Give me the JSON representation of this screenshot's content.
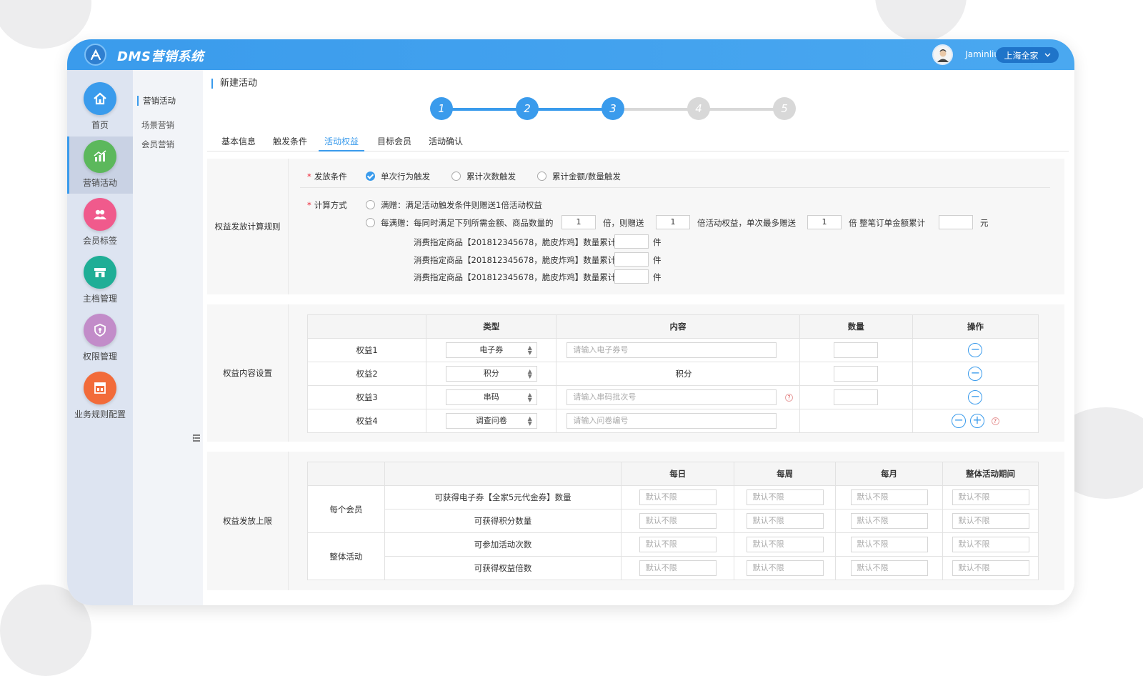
{
  "app": {
    "title": "DMS营销系统",
    "user": "Jaminliu",
    "store": "上海全家"
  },
  "sidebar": {
    "items": [
      {
        "label": "首页",
        "icon": "home-icon",
        "color": "#3a9bec"
      },
      {
        "label": "营销活动",
        "icon": "chart-icon",
        "color": "#5cb85c"
      },
      {
        "label": "会员标签",
        "icon": "members-icon",
        "color": "#f05a8c"
      },
      {
        "label": "主档管理",
        "icon": "store-icon",
        "color": "#1fae96"
      },
      {
        "label": "权限管理",
        "icon": "shield-icon",
        "color": "#c28cc9"
      },
      {
        "label": "业务规则配置",
        "icon": "rules-icon",
        "color": "#f26b3a"
      }
    ],
    "active_index": 1
  },
  "subnav": {
    "header": "营销活动",
    "items": [
      "场景营销",
      "会员营销"
    ]
  },
  "page": {
    "title": "新建活动",
    "steps": [
      "1",
      "2",
      "3",
      "4",
      "5"
    ],
    "current_step": 3,
    "tabs": [
      "基本信息",
      "触发条件",
      "活动权益",
      "目标会员",
      "活动确认"
    ],
    "active_tab": 2
  },
  "calc_rules": {
    "label": "权益发放计算规则",
    "trigger_label": "发放条件",
    "trigger_options": [
      "单次行为触发",
      "累计次数触发",
      "累计金额/数量触发"
    ],
    "trigger_selected": 0,
    "method_label": "计算方式",
    "method_option1": "满赠：满足活动触发条件则赠送1倍活动权益",
    "method_option2_prefix": "每满赠：每同时满足下列所需金额、商品数量的",
    "multiple_value": "1",
    "text_times_give": "倍，则赠送",
    "give_value": "1",
    "text_times_max": "倍活动权益，单次最多赠送",
    "max_value": "1",
    "text_times_order": "倍  整笔订单金额累计",
    "order_amount": "",
    "unit_yuan": "元",
    "product_lines": [
      "消费指定商品【201812345678，脆皮炸鸡】数量累计",
      "消费指定商品【201812345678，脆皮炸鸡】数量累计",
      "消费指定商品【201812345678，脆皮炸鸡】数量累计"
    ],
    "unit_piece": "件"
  },
  "benefit_content": {
    "label": "权益内容设置",
    "columns": [
      "",
      "类型",
      "内容",
      "数量",
      "操作"
    ],
    "rows": [
      {
        "name": "权益1",
        "type": "电子券",
        "content_placeholder": "请输入电子券号",
        "content_text": ""
      },
      {
        "name": "权益2",
        "type": "积分",
        "content_placeholder": "",
        "content_text": "积分"
      },
      {
        "name": "权益3",
        "type": "串码",
        "content_placeholder": "请输入串码批次号",
        "content_text": ""
      },
      {
        "name": "权益4",
        "type": "调查问卷",
        "content_placeholder": "请输入问卷编号",
        "content_text": ""
      }
    ],
    "remove_symbol": "−",
    "add_symbol": "+",
    "help_symbol": "?"
  },
  "limits": {
    "label": "权益发放上限",
    "columns": [
      "",
      "",
      "每日",
      "每周",
      "每月",
      "整体活动期间"
    ],
    "groups": [
      {
        "name": "每个会员",
        "rows": [
          "可获得电子券【全家5元代金券】数量",
          "可获得积分数量"
        ]
      },
      {
        "name": "整体活动",
        "rows": [
          "可参加活动次数",
          "可获得权益倍数"
        ]
      }
    ],
    "placeholder": "默认不限"
  },
  "colors": {
    "primary": "#3a9bec",
    "step_inactive": "#d8d8d8"
  }
}
